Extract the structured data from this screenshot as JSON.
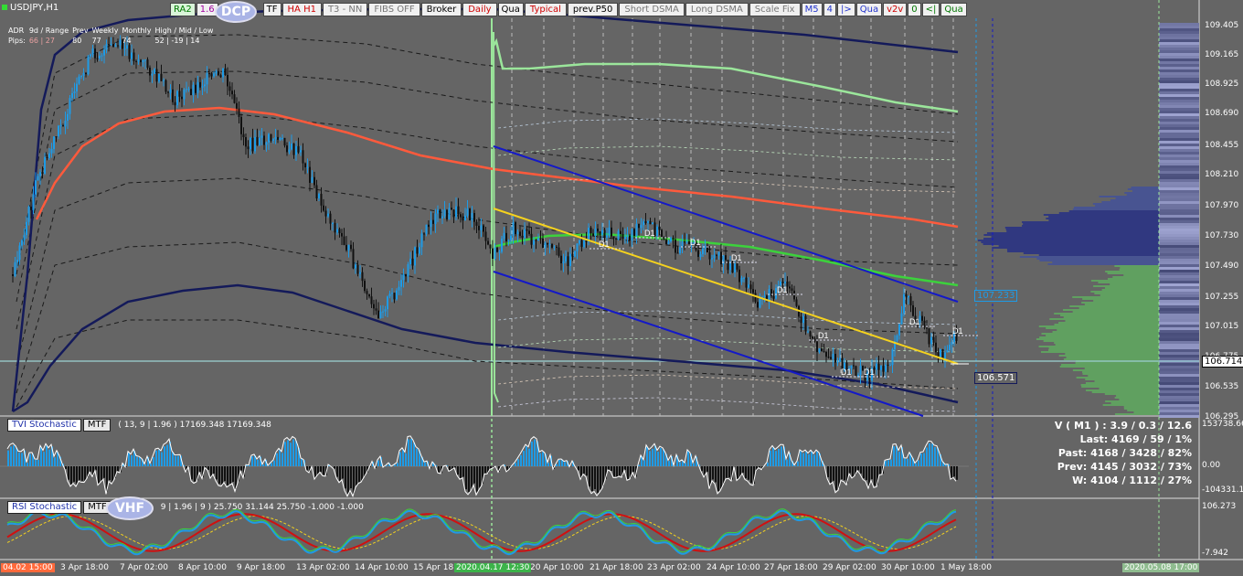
{
  "window": {
    "symbol": "USDJPY,H1"
  },
  "toolbar": [
    {
      "label": "RA2",
      "bg": "#d9f5d9",
      "fg": "#007700"
    },
    {
      "label": "1.6",
      "bg": "#f0f0f0",
      "fg": "#a000a0"
    },
    {
      "label": "TF",
      "bg": "#f0f0f0",
      "fg": "#000"
    },
    {
      "label": "HA H1",
      "bg": "#f0f0f0",
      "fg": "#d00000"
    },
    {
      "label": "T3 - NN",
      "bg": "#f0f0f0",
      "fg": "#777"
    },
    {
      "label": "FIBS OFF",
      "bg": "#f0f0f0",
      "fg": "#777"
    },
    {
      "label": "Broker",
      "bg": "#f0f0f0",
      "fg": "#000"
    },
    {
      "label": "Daily",
      "bg": "#f0f0f0",
      "fg": "#d00000"
    },
    {
      "label": "Qua",
      "bg": "#f0f0f0",
      "fg": "#000"
    },
    {
      "label": "Typical",
      "bg": "#f0f0f0",
      "fg": "#d00000"
    },
    {
      "label": "prev.P50",
      "bg": "#f0f0f0",
      "fg": "#000"
    },
    {
      "label": "Short DSMA",
      "bg": "#f0f0f0",
      "fg": "#777"
    },
    {
      "label": "Long DSMA",
      "bg": "#f0f0f0",
      "fg": "#777"
    },
    {
      "label": "Scale Fix",
      "bg": "#f0f0f0",
      "fg": "#777"
    },
    {
      "label": "M5",
      "bg": "#f0f0f0",
      "fg": "#2233cc"
    },
    {
      "label": "4",
      "bg": "#f0f0f0",
      "fg": "#2233cc"
    },
    {
      "label": "|>",
      "bg": "#f0f0f0",
      "fg": "#2233cc"
    },
    {
      "label": "Qua",
      "bg": "#f0f0f0",
      "fg": "#2233cc"
    },
    {
      "label": "v2v",
      "bg": "#f0f0f0",
      "fg": "#d00000"
    },
    {
      "label": "0",
      "bg": "#f0f0f0",
      "fg": "#007700"
    },
    {
      "label": "<|",
      "bg": "#f0f0f0",
      "fg": "#007700"
    },
    {
      "label": "Qua",
      "bg": "#f0f0f0",
      "fg": "#007700"
    }
  ],
  "badges": {
    "dcp": "DCP",
    "vhf": "VHF"
  },
  "adr": {
    "headers": [
      "ADR",
      "9d / Range",
      "Prev",
      "Weekly",
      "Monthly",
      "High / Mid / Low"
    ],
    "row_label": "Pips:",
    "values": [
      "66 | 27",
      "80",
      "77",
      "74",
      "52 | -19 | 14"
    ]
  },
  "price_axis": {
    "ticks": [
      "109.405",
      "109.165",
      "108.925",
      "108.690",
      "108.455",
      "108.210",
      "107.970",
      "107.730",
      "107.490",
      "107.255",
      "107.015",
      "106.775",
      "106.535",
      "106.295"
    ],
    "current_price": "106.714"
  },
  "price_marks": {
    "upper": "107.233",
    "lower": "106.571"
  },
  "chart_labels": {
    "d1": "D1"
  },
  "tvi_panel": {
    "label": "TVI Stochastic",
    "mtf": "MTF",
    "params": "( 13, 9 | 1.96 ) 17169.348 17169.348",
    "ticks": [
      "153738.66",
      "0.00",
      "-104331.17"
    ]
  },
  "rsi_panel": {
    "label": "RSI Stochastic",
    "mtf": "MTF",
    "params": "9 | 1.96 | 9 ) 25.750 31.144 25.750 -1.000 -1.000",
    "ticks": [
      "106.273",
      "-7.942"
    ]
  },
  "stats": {
    "line1": "V ( M1 ) : 3.9 / 0.3 / 12.6",
    "line2": "Last: 4169 / 59 / 1%",
    "line3": "Past: 4168 / 3428 / 82%",
    "line4": "Prev: 4145 / 3032 / 73%",
    "line5": "W: 4104 / 1112 / 27%"
  },
  "time_axis": {
    "labels": [
      "3 Apr 18:00",
      "7 Apr 02:00",
      "8 Apr 10:00",
      "9 Apr 18:00",
      "13 Apr 02:00",
      "14 Apr 10:00",
      "15 Apr 18:00",
      "20 Apr 10:00",
      "21 Apr 18:00",
      "23 Apr 02:00",
      "24 Apr 10:00",
      "27 Apr 18:00",
      "29 Apr 02:00",
      "30 Apr 10:00",
      "1 May 18:00"
    ],
    "start_box": "04.02 15:00",
    "mid_box": "2020.04.17 12:30",
    "end_box": "2020.05.08 17:00"
  },
  "colors": {
    "background": "#656565",
    "bull_candle": "#1e9be6",
    "bear_candle": "#111111",
    "ma_red": "#ff5a3c",
    "ma_navy": "#141a5a",
    "green_line": "#9be69b",
    "channel_blue": "#1419c8",
    "regression_yellow": "#f5d21e"
  }
}
